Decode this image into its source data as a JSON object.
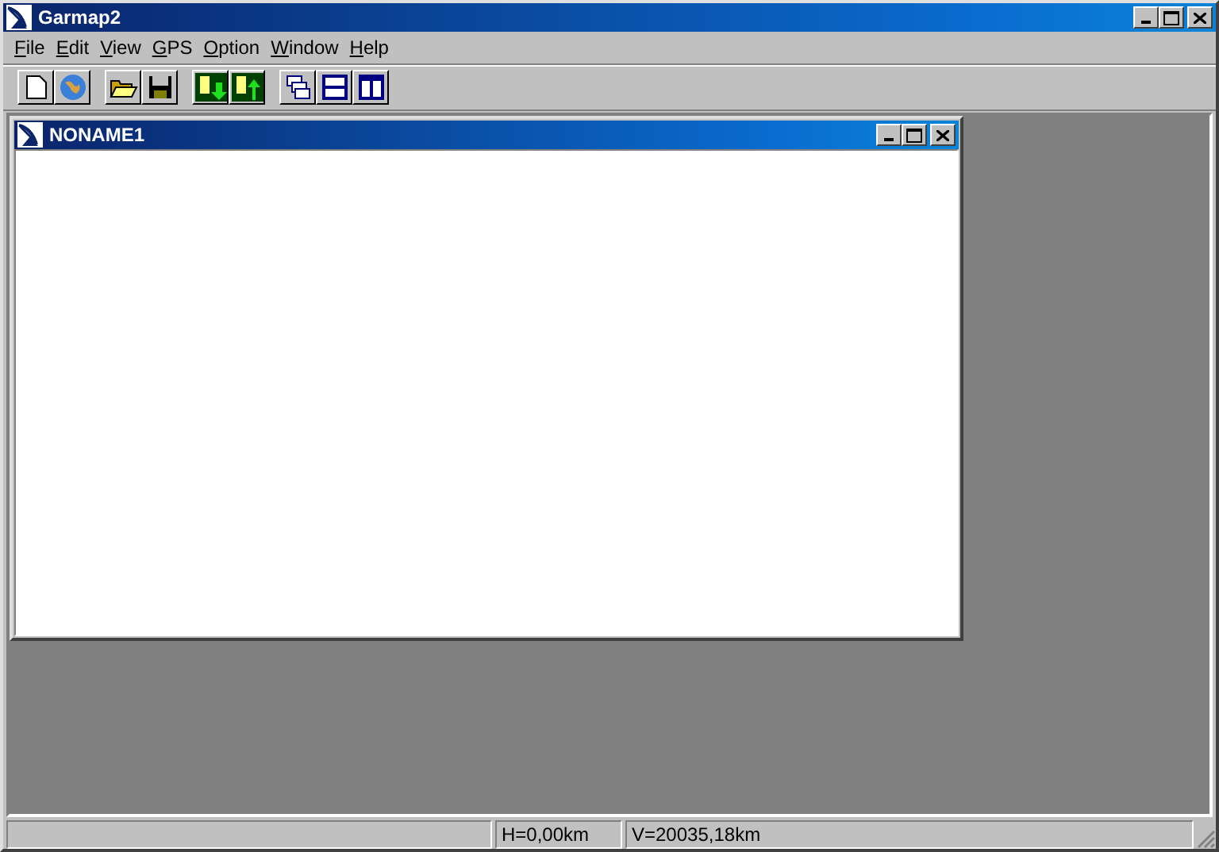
{
  "window": {
    "title": "Garmap2"
  },
  "menu": [
    "File",
    "Edit",
    "View",
    "GPS",
    "Option",
    "Window",
    "Help"
  ],
  "child_window": {
    "title": "NONAME1"
  },
  "status_bar": [
    "H=0,00km",
    "V=20035,18km"
  ]
}
